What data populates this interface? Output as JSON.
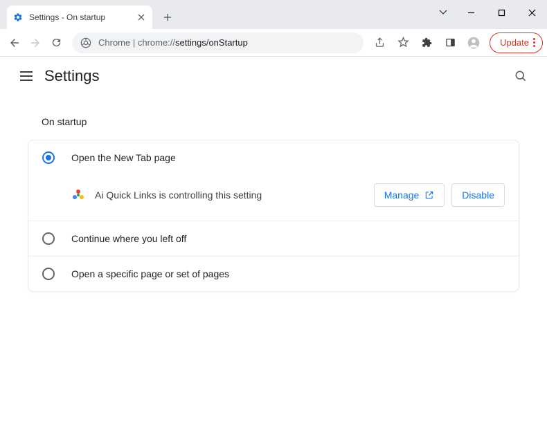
{
  "tab": {
    "title": "Settings - On startup"
  },
  "address": {
    "prefix": "Chrome | chrome://",
    "path": "settings/onStartup"
  },
  "update": {
    "label": "Update"
  },
  "header": {
    "title": "Settings"
  },
  "section": {
    "title": "On startup"
  },
  "options": {
    "opt0": "Open the New Tab page",
    "opt1": "Continue where you left off",
    "opt2": "Open a specific page or set of pages"
  },
  "extension": {
    "message": "Ai Quick Links is controlling this setting",
    "manage": "Manage",
    "disable": "Disable"
  }
}
